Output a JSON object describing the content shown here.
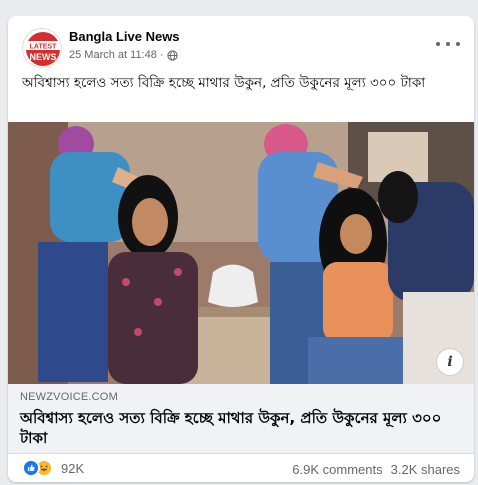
{
  "post": {
    "page_name": "Bangla Live News",
    "timestamp": "25 March at 11:48",
    "separator": "·",
    "privacy_icon": "globe-icon",
    "avatar_text_top": "LATEST",
    "avatar_text_bottom": "NEWS",
    "caption": "অবিশ্বাস্য হলেও সত্য বিক্রি হচ্ছে মাথার উকুন, প্রতি উকুনের মূল্য ৩০০ টাকা"
  },
  "link_preview": {
    "domain": "NEWZVOICE.COM",
    "title": "অবিশ্বাস্য হলেও সত্য বিক্রি হচ্ছে মাথার উকুন, প্রতি উকুনের মূল্য ৩০০ টাকা",
    "info_icon_label": "i"
  },
  "engagement": {
    "reaction_count": "92K",
    "comments": "6.9K comments",
    "shares": "3.2K shares"
  },
  "colors": {
    "accent": "#1877f2",
    "haha": "#f7b928",
    "avatar_red": "#d32f2f",
    "background": "#e9ebee"
  }
}
